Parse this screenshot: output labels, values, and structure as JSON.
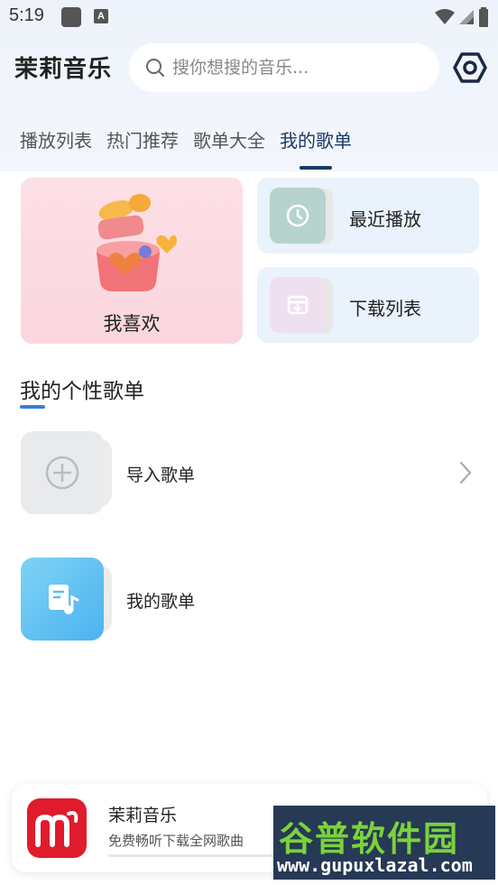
{
  "status_bar": {
    "time": "5:19",
    "notification_letter": "A"
  },
  "header": {
    "app_title": "茉莉音乐",
    "search_placeholder": "搜你想搜的音乐..."
  },
  "tabs": [
    {
      "label": "播放列表",
      "active": false
    },
    {
      "label": "热门推荐",
      "active": false
    },
    {
      "label": "歌单大全",
      "active": false
    },
    {
      "label": "我的歌单",
      "active": true
    }
  ],
  "quick_cards": {
    "favorites": {
      "label": "我喜欢"
    },
    "recent": {
      "label": "最近播放",
      "icon": "clock-icon"
    },
    "downloads": {
      "label": "下载列表",
      "icon": "download-box-icon"
    }
  },
  "section": {
    "title": "我的个性歌单"
  },
  "playlists": [
    {
      "label": "导入歌单",
      "icon": "plus-circle-icon"
    },
    {
      "label": "我的歌单",
      "icon": "music-note-doc-icon"
    }
  ],
  "banner": {
    "title": "茉莉音乐",
    "subtitle": "免费畅听下载全网歌曲"
  },
  "watermark": {
    "main": "谷普软件园",
    "sub": "www.gupuxlazal.com"
  },
  "colors": {
    "accent": "#1a3a63",
    "section_underline": "#3b7dd8",
    "favorites_bg": "#fbd6de",
    "card_bg": "#eaf2fb",
    "brand_red": "#e01b2b"
  }
}
